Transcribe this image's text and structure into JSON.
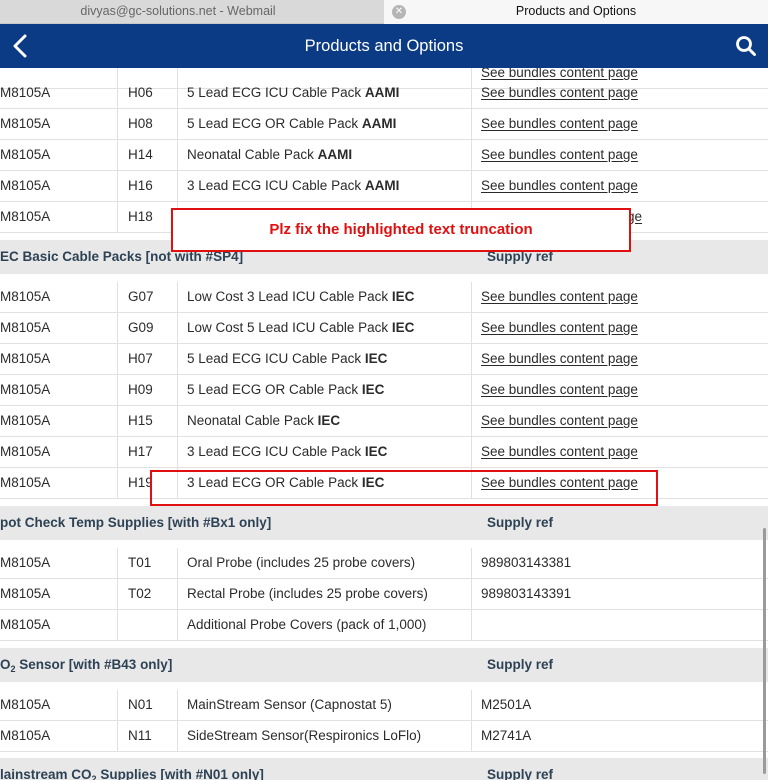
{
  "browser_tabs": [
    {
      "label": "divyas@gc-solutions.net - Webmail",
      "active": false
    },
    {
      "label": "Products and Options",
      "active": true
    }
  ],
  "header": {
    "title": "Products and Options",
    "back_icon": "chevron-left-icon",
    "search_icon": "search-icon"
  },
  "top_partial_row": {
    "link": "See bundles content page"
  },
  "group_aami": {
    "rows": [
      {
        "model": "M8105A",
        "code": "H06",
        "desc": "5 Lead ECG ICU Cable Pack ",
        "std": "AAMI",
        "ref": "See bundles content page"
      },
      {
        "model": "M8105A",
        "code": "H08",
        "desc": "5 Lead ECG OR Cable Pack ",
        "std": "AAMI",
        "ref": "See bundles content page"
      },
      {
        "model": "M8105A",
        "code": "H14",
        "desc": "Neonatal Cable Pack ",
        "std": "AAMI",
        "ref": "See bundles content page"
      },
      {
        "model": "M8105A",
        "code": "H16",
        "desc": "3 Lead ECG ICU Cable Pack ",
        "std": "AAMI",
        "ref": "See bundles content page"
      },
      {
        "model": "M8105A",
        "code": "H18",
        "desc": "",
        "std": "",
        "ref": "ge"
      }
    ]
  },
  "section_iec": {
    "title": "EC Basic Cable Packs [not with #SP4]",
    "ref_header": "Supply ref"
  },
  "group_iec": {
    "rows": [
      {
        "model": "M8105A",
        "code": "G07",
        "desc": "Low Cost 3 Lead ICU Cable Pack ",
        "std": "IEC",
        "ref": "See bundles content page"
      },
      {
        "model": "M8105A",
        "code": "G09",
        "desc": "Low Cost 5 Lead ICU Cable Pack ",
        "std": "IEC",
        "ref": "See bundles content page"
      },
      {
        "model": "M8105A",
        "code": "H07",
        "desc": "5 Lead ECG ICU Cable Pack ",
        "std": "IEC",
        "ref": "See bundles content page"
      },
      {
        "model": "M8105A",
        "code": "H09",
        "desc": "5 Lead ECG OR Cable Pack ",
        "std": "IEC",
        "ref": "See bundles content page"
      },
      {
        "model": "M8105A",
        "code": "H15",
        "desc": "Neonatal Cable Pack ",
        "std": "IEC",
        "ref": "See bundles content page"
      },
      {
        "model": "M8105A",
        "code": "H17",
        "desc": "3 Lead ECG ICU Cable Pack ",
        "std": "IEC",
        "ref": "See bundles content page"
      },
      {
        "model": "M8105A",
        "code": "H19",
        "desc": "3 Lead ECG OR Cable Pack ",
        "std": "IEC",
        "ref": "See bundles content page"
      }
    ]
  },
  "section_temp": {
    "title": "pot Check Temp Supplies [with #Bx1 only]",
    "ref_header": "Supply ref"
  },
  "group_temp": {
    "rows": [
      {
        "model": "M8105A",
        "code": "T01",
        "desc": "Oral Probe (includes 25 probe covers)",
        "ref": "989803143381"
      },
      {
        "model": "M8105A",
        "code": "T02",
        "desc": "Rectal Probe (includes 25 probe covers)",
        "ref": "989803143391"
      },
      {
        "model": "M8105A",
        "code": "",
        "desc": "Additional Probe Covers (pack of 1,000)",
        "ref": ""
      }
    ]
  },
  "section_co2": {
    "title_pre": "O",
    "title_sub": "2",
    "title_post": " Sensor [with #B43 only]",
    "ref_header": "Supply ref"
  },
  "group_co2": {
    "rows": [
      {
        "model": "M8105A",
        "code": "N01",
        "desc": "MainStream Sensor (Capnostat 5)",
        "ref": "M2501A"
      },
      {
        "model": "M8105A",
        "code": "N11",
        "desc": "SideStream Sensor(Respironics LoFlo)",
        "ref": "M2741A"
      }
    ]
  },
  "section_co2_supplies": {
    "title_pre": "lainstream CO",
    "title_sub": "2",
    "title_post": " Supplies [with #N01 only]",
    "ref_header": "Supply ref"
  },
  "annotation": {
    "note": "Plz fix the highlighted text truncation",
    "color": "#e01010"
  },
  "colors": {
    "header_bg": "#0b3b84",
    "section_bg": "#e8e8e8",
    "section_text": "#2d4255"
  }
}
